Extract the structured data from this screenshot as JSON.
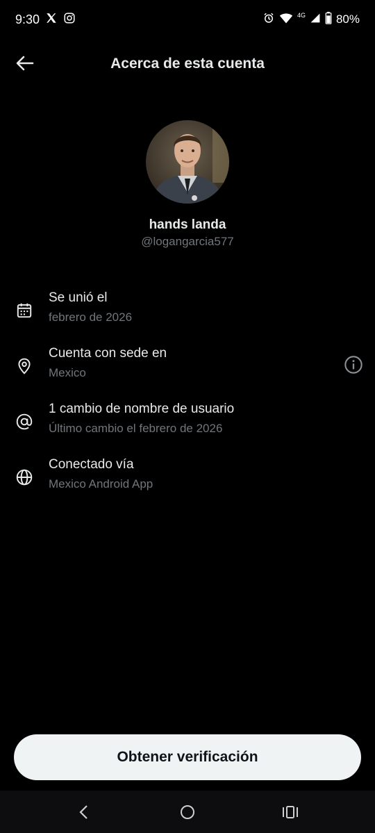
{
  "status_bar": {
    "time": "9:30",
    "battery": "80%",
    "network": "4G",
    "icons": [
      "x-logo-icon",
      "instagram-icon",
      "alarm-icon",
      "wifi-icon",
      "signal-icon",
      "battery-icon"
    ]
  },
  "header": {
    "title": "Acerca de esta cuenta",
    "back_icon": "arrow-left-icon"
  },
  "profile": {
    "name": "hands landa",
    "handle": "@logangarcia577"
  },
  "info": [
    {
      "icon": "calendar-icon",
      "title": "Se unió el",
      "subtitle": "febrero de 2026"
    },
    {
      "icon": "location-pin-icon",
      "title": "Cuenta con sede en",
      "subtitle": "Mexico",
      "extra_icon": "info-icon"
    },
    {
      "icon": "at-sign-icon",
      "title": "1 cambio de nombre de usuario",
      "subtitle": "Último cambio el febrero de 2026"
    },
    {
      "icon": "globe-icon",
      "title": "Conectado vía",
      "subtitle": "Mexico Android App"
    }
  ],
  "action": {
    "verify_label": "Obtener verificación"
  },
  "colors": {
    "background": "#000000",
    "primary_text": "#e7e9ea",
    "secondary_text": "#71767b",
    "button_bg": "#eff3f4",
    "button_text": "#0f1419"
  }
}
